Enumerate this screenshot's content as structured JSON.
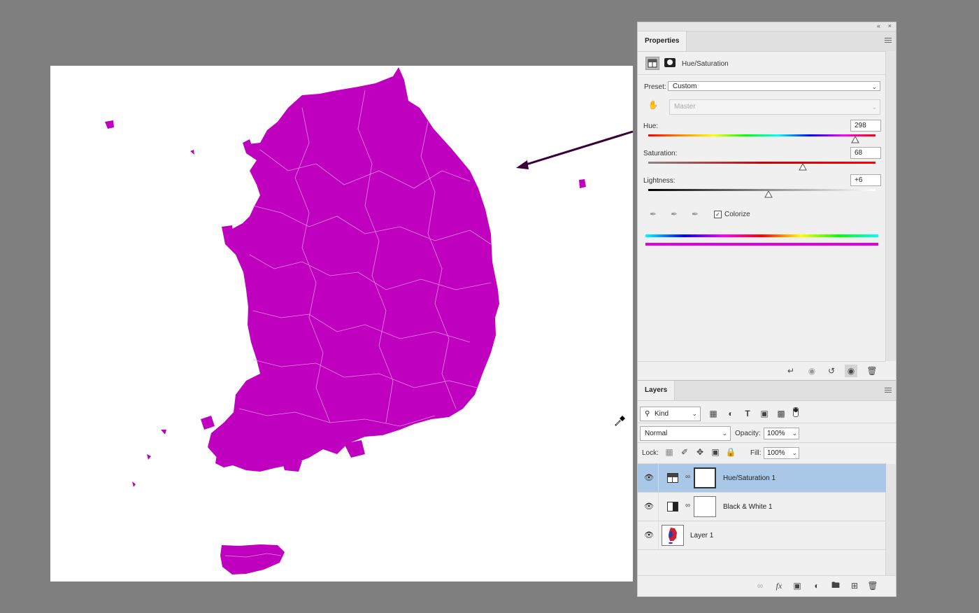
{
  "colors": {
    "magenta": "#bf00bf",
    "selected_row": "#a9c8e8",
    "arrow": "#3a0038"
  },
  "canvas": {
    "cursor": "eyedropper-icon"
  },
  "panel": {
    "collapse_glyph": "«",
    "close_glyph": "×",
    "properties": {
      "tab_label": "Properties",
      "adjustment_title": "Hue/Saturation",
      "preset_label": "Preset:",
      "preset_value": "Custom",
      "channel_value": "Master",
      "hue_label": "Hue:",
      "hue_value": "298",
      "hue_fraction": 0.91,
      "saturation_label": "Saturation:",
      "saturation_value": "68",
      "saturation_fraction": 0.68,
      "lightness_label": "Lightness:",
      "lightness_value": "+6",
      "lightness_fraction": 0.53,
      "colorize_label": "Colorize",
      "colorize_checked": true
    },
    "layers": {
      "tab_label": "Layers",
      "kind_label": "Kind",
      "blend_mode": "Normal",
      "opacity_label": "Opacity:",
      "opacity_value": "100%",
      "lock_label": "Lock:",
      "fill_label": "Fill:",
      "fill_value": "100%",
      "filter_glyphs": [
        "T"
      ],
      "items": [
        {
          "name": "Hue/Saturation 1",
          "selected": true
        },
        {
          "name": "Black & White 1",
          "selected": false
        },
        {
          "name": "Layer 1",
          "selected": false
        }
      ]
    }
  }
}
